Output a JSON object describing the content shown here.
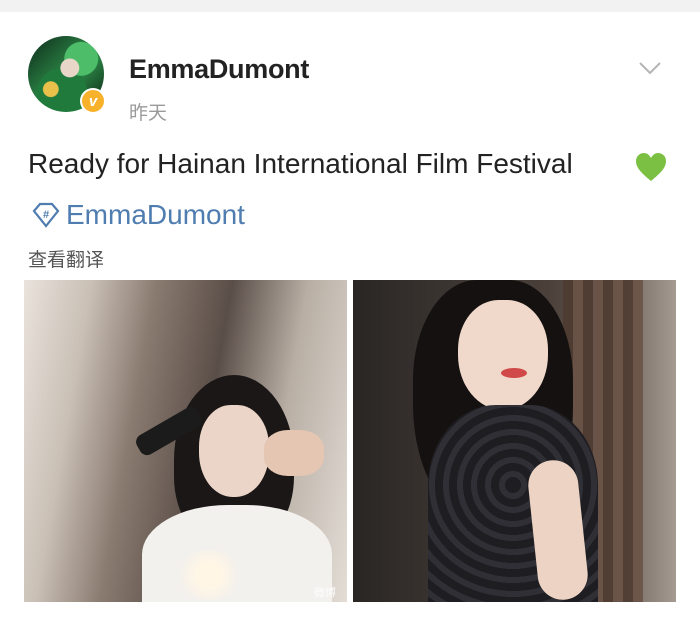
{
  "post": {
    "author": "EmmaDumont",
    "verified_mark": "v",
    "timestamp": "昨天",
    "text": "Ready for Hainan International Film Festival",
    "emoji": "green-heart",
    "mention": "EmmaDumont",
    "translate_label": "查看翻译",
    "watermark": "微博",
    "photos": [
      {
        "alt": "makeup"
      },
      {
        "alt": "portrait"
      }
    ]
  },
  "colors": {
    "link": "#4f7db0",
    "verified": "#f7b12b",
    "heart": "#7bc043"
  },
  "icons": {
    "menu": "chevron-down-icon",
    "mention": "super-topic-diamond-icon",
    "emoji": "green-heart-icon"
  }
}
